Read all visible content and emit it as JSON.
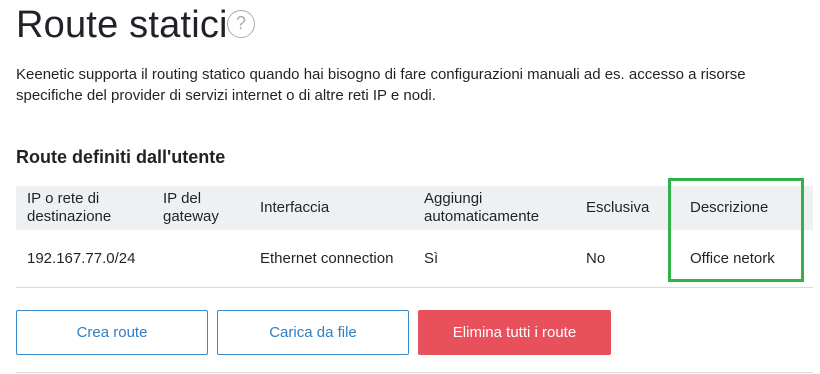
{
  "page": {
    "title": "Route statici",
    "help_icon": "question-circle-icon",
    "description": "Keenetic supporta il routing statico quando hai bisogno di fare configurazioni manuali ad es. accesso a risorse specifiche del provider di servizi internet o di altre reti IP e nodi."
  },
  "section": {
    "title": "Route definiti dall'utente"
  },
  "table": {
    "headers": [
      "IP o rete di destinazione",
      "IP del gateway",
      "Interfaccia",
      "Aggiungi automaticamente",
      "Esclusiva",
      "Descrizione"
    ],
    "rows": [
      {
        "destination": "192.167.77.0/24",
        "gateway": "",
        "interface": "Ethernet connection",
        "auto_add": "Sì",
        "exclusive": "No",
        "description": "Office netork"
      }
    ],
    "highlight_color": "#33b24b"
  },
  "buttons": {
    "create": "Crea route",
    "upload": "Carica da file",
    "delete_all": "Elimina tutti i route"
  },
  "colors": {
    "accent": "#2f7fc2",
    "danger": "#e8505b",
    "header_bg": "#eef0f2"
  }
}
